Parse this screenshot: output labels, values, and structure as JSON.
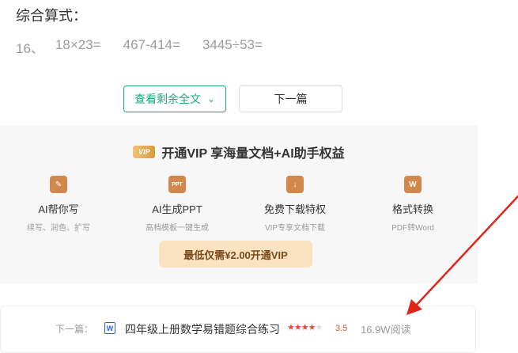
{
  "heading": "综合算式：",
  "problems": [
    "16、",
    "18×23=",
    "467-414=",
    "3445÷53="
  ],
  "buttons": {
    "view_more": "查看剩余全文",
    "next": "下一篇"
  },
  "vip": {
    "badge": "VIP",
    "headline": "开通VIP 享海量文档+AI助手权益",
    "features": [
      {
        "icon_text": "✎",
        "icon": "edit-icon",
        "name": "AI帮你写",
        "desc": "续写、润色、扩写"
      },
      {
        "icon_text": "PPT",
        "icon": "ppt-icon",
        "name": "AI生成PPT",
        "desc": "高档模板一键生成"
      },
      {
        "icon_text": "↓",
        "icon": "download-icon",
        "name": "免费下载特权",
        "desc": "VIP专享文档下载"
      },
      {
        "icon_text": "W",
        "icon": "word-convert-icon",
        "name": "格式转换",
        "desc": "PDF转Word"
      }
    ],
    "cta": "最低仅需¥2.00开通VIP"
  },
  "next_doc": {
    "label": "下一篇：",
    "file_icon": "W",
    "title": "四年级上册数学易错题综合练习",
    "stars_full": 3.5,
    "rating": "3.5",
    "reads": "16.9W阅读"
  },
  "colors": {
    "accent": "#1ea97c",
    "vip_orange": "#d2884a",
    "arrow_red": "#e2231a"
  }
}
